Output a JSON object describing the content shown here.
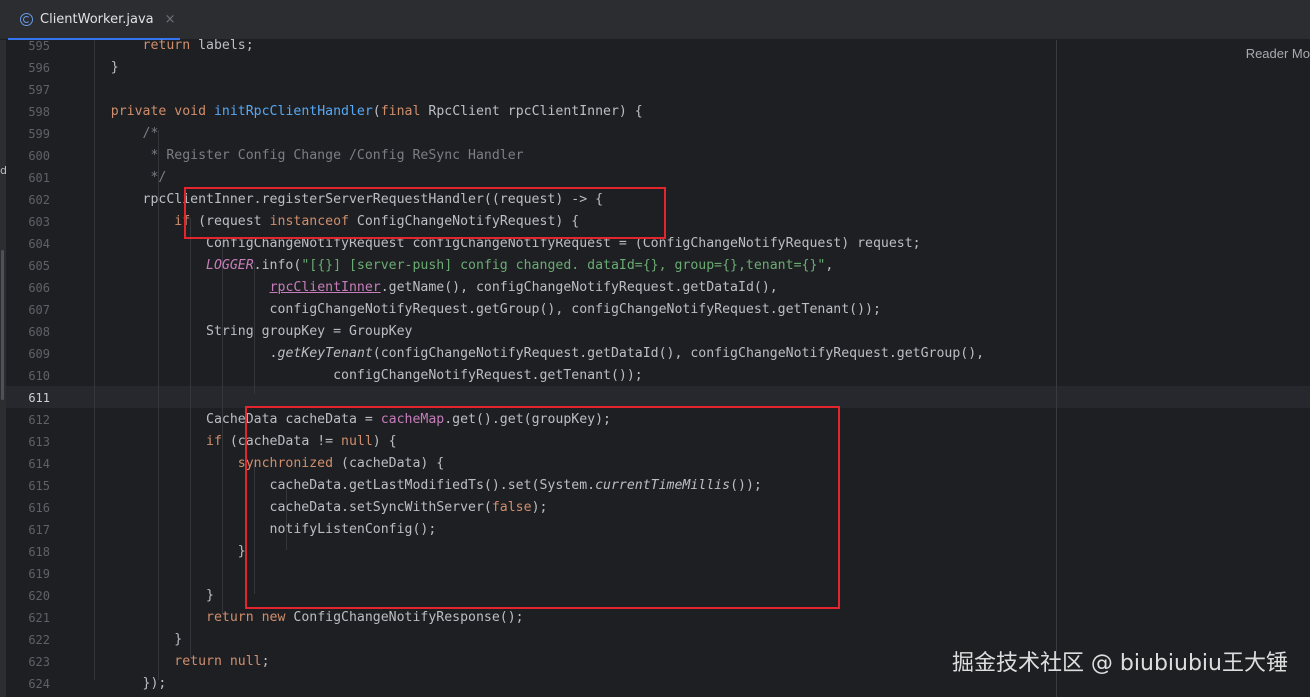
{
  "tab": {
    "filename": "ClientWorker.java",
    "close_glyph": "×"
  },
  "reader_mode": "Reader Mo",
  "left_strip_mark": "di",
  "watermark": "掘金技术社区 @ biubiubiu王大锤",
  "active_line": "611",
  "highlight_color": "#e3262d",
  "lines": [
    {
      "n": "595",
      "s": [
        [
          "kw",
          "        return "
        ],
        [
          "p",
          "labels;"
        ]
      ]
    },
    {
      "n": "596",
      "s": [
        [
          "p",
          "    }"
        ]
      ]
    },
    {
      "n": "597",
      "s": []
    },
    {
      "n": "598",
      "s": [
        [
          "kw",
          "    private void "
        ],
        [
          "fn",
          "initRpcClientHandler"
        ],
        [
          "p",
          "("
        ],
        [
          "kw",
          "final "
        ],
        [
          "p",
          "RpcClient rpcClientInner) {"
        ]
      ]
    },
    {
      "n": "599",
      "s": [
        [
          "cm",
          "        /*"
        ]
      ]
    },
    {
      "n": "600",
      "s": [
        [
          "cm",
          "         * Register Config Change /Config ReSync Handler"
        ]
      ]
    },
    {
      "n": "601",
      "s": [
        [
          "cm",
          "         */"
        ]
      ]
    },
    {
      "n": "602",
      "s": [
        [
          "p",
          "        rpcClientInner.registerServerRequestHandler((request) -> {"
        ]
      ]
    },
    {
      "n": "603",
      "s": [
        [
          "kw",
          "            if "
        ],
        [
          "p",
          "(request "
        ],
        [
          "kw",
          "instanceof "
        ],
        [
          "p",
          "ConfigChangeNotifyRequest) {"
        ]
      ]
    },
    {
      "n": "604",
      "s": [
        [
          "p",
          "                ConfigChangeNotifyRequest configChangeNotifyRequest = (ConfigChangeNotifyRequest) request;"
        ]
      ]
    },
    {
      "n": "605",
      "s": [
        [
          "fld it",
          "                LOGGER"
        ],
        [
          "p",
          ".info("
        ],
        [
          "str",
          "\"[{}] [server-push] config changed. dataId={}, group={},tenant={}\""
        ],
        [
          "p",
          ","
        ]
      ]
    },
    {
      "n": "606",
      "s": [
        [
          "p",
          "                        "
        ],
        [
          "fld und",
          "rpcClientInner"
        ],
        [
          "p",
          ".getName(), configChangeNotifyRequest.getDataId(),"
        ]
      ]
    },
    {
      "n": "607",
      "s": [
        [
          "p",
          "                        configChangeNotifyRequest.getGroup(), configChangeNotifyRequest.getTenant());"
        ]
      ]
    },
    {
      "n": "608",
      "s": [
        [
          "p",
          "                String groupKey = GroupKey"
        ]
      ]
    },
    {
      "n": "609",
      "s": [
        [
          "p",
          "                        ."
        ],
        [
          "it",
          "getKeyTenant"
        ],
        [
          "p",
          "(configChangeNotifyRequest.getDataId(), configChangeNotifyRequest.getGroup(),"
        ]
      ]
    },
    {
      "n": "610",
      "s": [
        [
          "p",
          "                                configChangeNotifyRequest.getTenant());"
        ]
      ]
    },
    {
      "n": "611",
      "s": []
    },
    {
      "n": "612",
      "s": [
        [
          "p",
          "                CacheData cacheData = "
        ],
        [
          "fld",
          "cacheMap"
        ],
        [
          "p",
          ".get().get(groupKey);"
        ]
      ]
    },
    {
      "n": "613",
      "s": [
        [
          "kw",
          "                if "
        ],
        [
          "p",
          "(cacheData != "
        ],
        [
          "kw",
          "null"
        ],
        [
          "p",
          ") {"
        ]
      ]
    },
    {
      "n": "614",
      "s": [
        [
          "kw",
          "                    synchronized "
        ],
        [
          "p",
          "(cacheData) {"
        ]
      ]
    },
    {
      "n": "615",
      "s": [
        [
          "p",
          "                        cacheData.getLastModifiedTs().set(System."
        ],
        [
          "it",
          "currentTimeMillis"
        ],
        [
          "p",
          "());"
        ]
      ]
    },
    {
      "n": "616",
      "s": [
        [
          "p",
          "                        cacheData.setSyncWithServer("
        ],
        [
          "kw",
          "false"
        ],
        [
          "p",
          ");"
        ]
      ]
    },
    {
      "n": "617",
      "s": [
        [
          "p",
          "                        notifyListenConfig();"
        ]
      ]
    },
    {
      "n": "618",
      "s": [
        [
          "p",
          "                    }"
        ]
      ]
    },
    {
      "n": "619",
      "s": []
    },
    {
      "n": "620",
      "s": [
        [
          "p",
          "                }"
        ]
      ]
    },
    {
      "n": "621",
      "s": [
        [
          "kw",
          "                return new "
        ],
        [
          "p",
          "ConfigChangeNotifyResponse();"
        ]
      ]
    },
    {
      "n": "622",
      "s": [
        [
          "p",
          "            }"
        ]
      ]
    },
    {
      "n": "623",
      "s": [
        [
          "kw",
          "            return null"
        ],
        [
          "p",
          ";"
        ]
      ]
    },
    {
      "n": "624",
      "s": [
        [
          "p",
          "        });"
        ]
      ]
    }
  ]
}
